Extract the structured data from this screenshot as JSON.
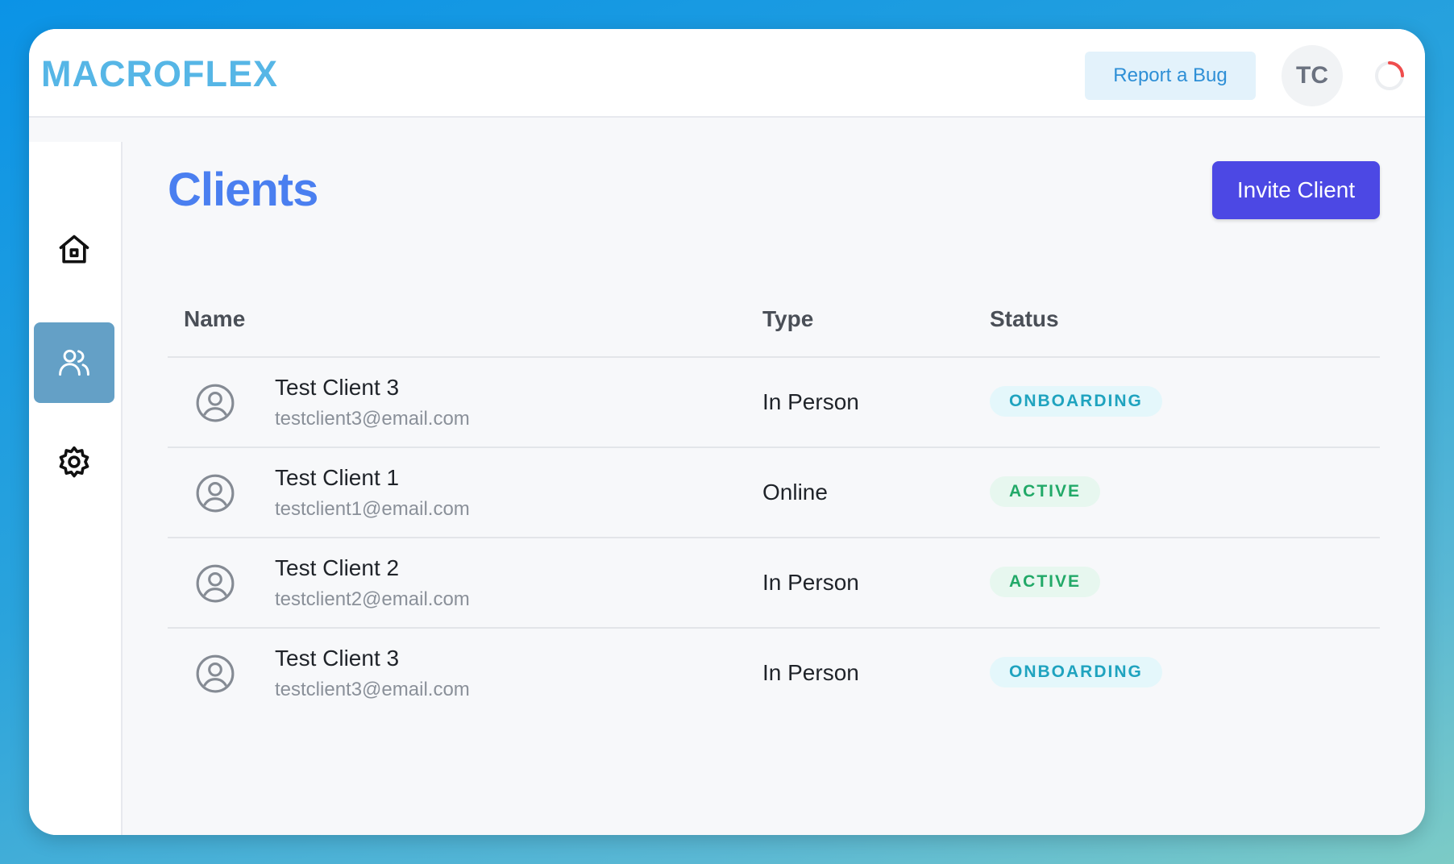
{
  "app": {
    "logo_text": "MACROFLEX",
    "brand_color": "#56b6e6"
  },
  "header": {
    "report_bug_label": "Report a Bug",
    "avatar_initials": "TC",
    "loading_indicator": "spinner-icon"
  },
  "sidebar": {
    "items": [
      {
        "name": "home",
        "icon": "home-icon",
        "active": false
      },
      {
        "name": "clients",
        "icon": "users-icon",
        "active": true
      },
      {
        "name": "settings",
        "icon": "gear-icon",
        "active": false
      }
    ],
    "active_color": "#64a0c6"
  },
  "main": {
    "title": "Clients",
    "invite_button_label": "Invite Client",
    "invite_button_color": "#4c48e4"
  },
  "table": {
    "columns": [
      "Name",
      "Type",
      "Status"
    ],
    "rows": [
      {
        "name": "Test Client 3",
        "email": "testclient3@email.com",
        "type": "In Person",
        "status": "ONBOARDING"
      },
      {
        "name": "Test Client 1",
        "email": "testclient1@email.com",
        "type": "Online",
        "status": "ACTIVE"
      },
      {
        "name": "Test Client 2",
        "email": "testclient2@email.com",
        "type": "In Person",
        "status": "ACTIVE"
      },
      {
        "name": "Test Client 3",
        "email": "testclient3@email.com",
        "type": "In Person",
        "status": "ONBOARDING"
      }
    ]
  },
  "colors": {
    "onboarding": "#1fa3bf",
    "active": "#22a968"
  }
}
